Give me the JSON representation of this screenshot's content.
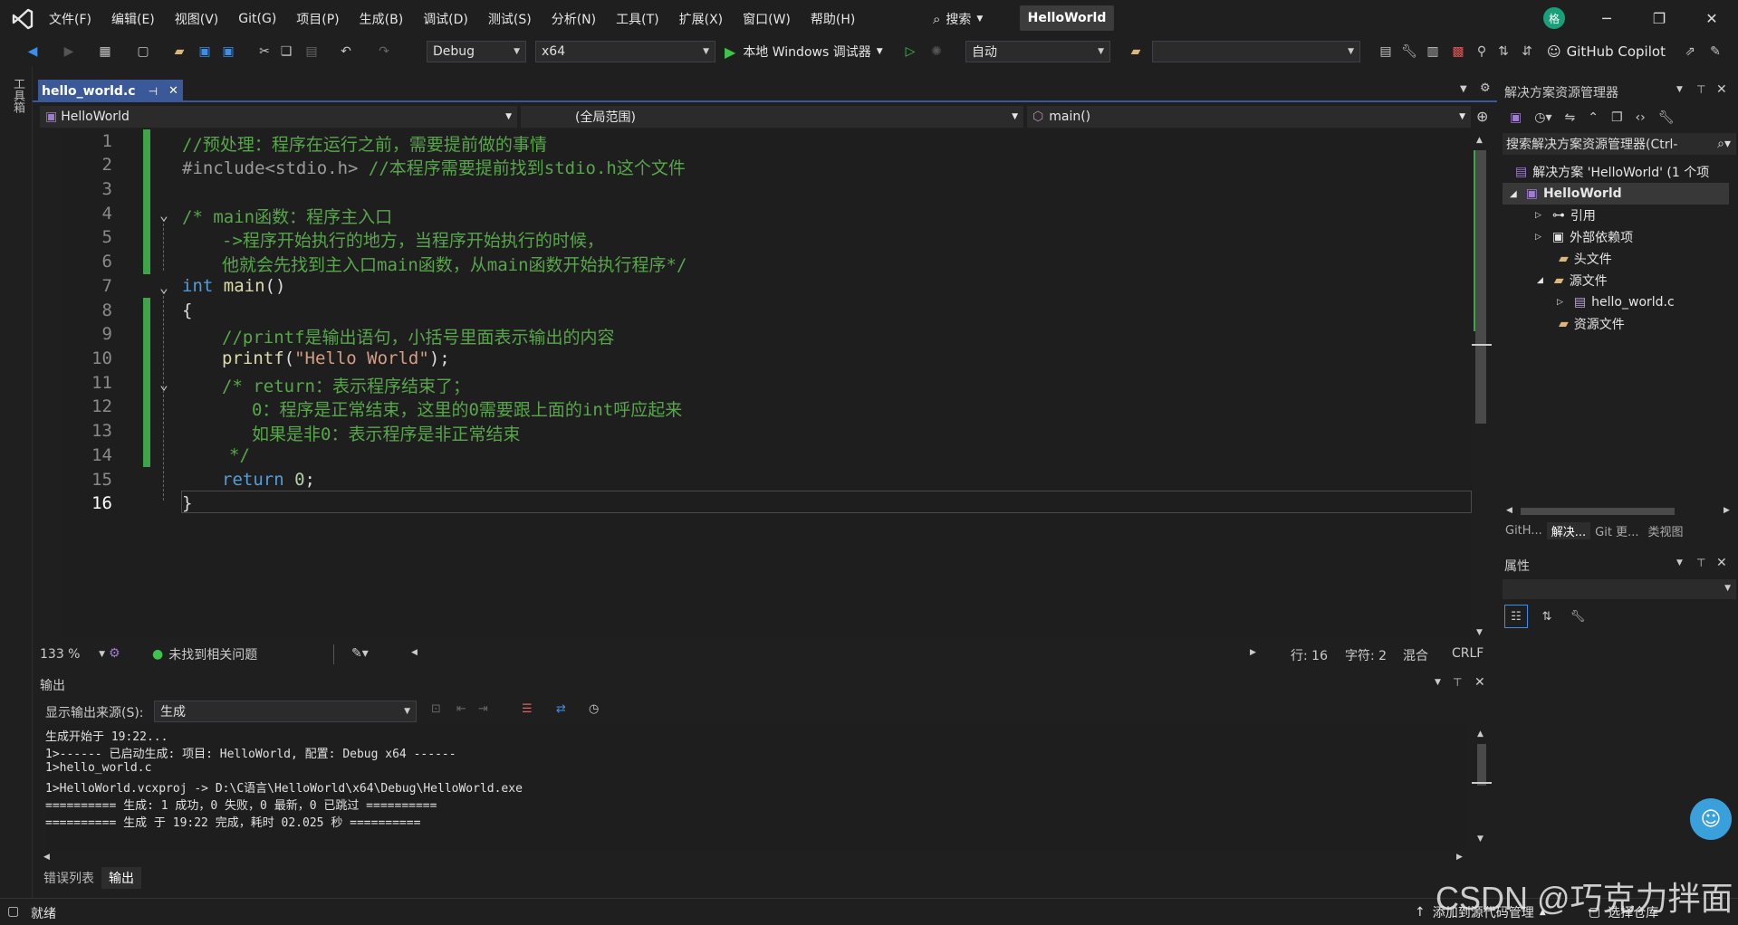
{
  "menu": {
    "items": [
      "文件(F)",
      "编辑(E)",
      "视图(V)",
      "Git(G)",
      "项目(P)",
      "生成(B)",
      "调试(D)",
      "测试(S)",
      "分析(N)",
      "工具(T)",
      "扩展(X)",
      "窗口(W)",
      "帮助(H)"
    ],
    "search": "搜索",
    "project_title": "HelloWorld",
    "avatar_initial": "格"
  },
  "toolbar": {
    "config": "Debug",
    "platform": "x64",
    "debugger_label": "本地 Windows 调试器",
    "auto_label": "自动",
    "copilot_label": "GitHub Copilot"
  },
  "leftrail": {
    "toolbox_label": "工具箱"
  },
  "editor": {
    "tab_label": "hello_world.c",
    "nav_project": "HelloWorld",
    "nav_scope": "(全局范围)",
    "nav_function": "main()",
    "line_numbers": [
      "1",
      "2",
      "3",
      "4",
      "5",
      "6",
      "7",
      "8",
      "9",
      "10",
      "11",
      "12",
      "13",
      "14",
      "15",
      "16"
    ],
    "lines": {
      "l1": "//预处理：程序在运行之前，需要提前做的事情",
      "l2a": "#include<stdio.h>",
      "l2b": " //本程序需要提前找到stdio.h这个文件",
      "l4": "/* main函数：程序主入口",
      "l5": "->程序开始执行的地方，当程序开始执行的时候，",
      "l6": "他就会先找到主入口main函数，从main函数开始执行程序*/",
      "l7kw": "int",
      "l7fn": "main",
      "l7p": "()",
      "l8": "{",
      "l9": "//printf是输出语句，小括号里面表示输出的内容",
      "l10fn": "printf",
      "l10a": "(",
      "l10s": "\"Hello World\"",
      "l10b": ");",
      "l11": "/* return：表示程序结束了；",
      "l12": "0：程序是正常结束，这里的0需要跟上面的int呼应起来",
      "l13": "如果是非0：表示程序是非正常结束",
      "l14": "*/",
      "l15kw": "return",
      "l15n": "0",
      "l15e": ";",
      "l16": "}"
    },
    "status": {
      "zoom": "133 %",
      "issues": "未找到相关问题",
      "line": "行: 16",
      "char": "字符: 2",
      "mode": "混合",
      "eol": "CRLF"
    }
  },
  "output": {
    "title": "输出",
    "source_label": "显示输出来源(S):",
    "source_value": "生成",
    "lines": [
      "生成开始于 19:22...",
      "1>------ 已启动生成: 项目: HelloWorld, 配置: Debug x64 ------",
      "1>hello_world.c",
      "1>HelloWorld.vcxproj -> D:\\C语言\\HelloWorld\\x64\\Debug\\HelloWorld.exe",
      "========== 生成: 1 成功，0 失败，0 最新，0 已跳过 ==========",
      "========== 生成 于 19:22 完成，耗时 02.025 秒 =========="
    ],
    "tabs": [
      "错误列表",
      "输出"
    ]
  },
  "solution": {
    "title": "解决方案资源管理器",
    "search_placeholder": "搜索解决方案资源管理器(Ctrl-",
    "root": "解决方案 'HelloWorld' (1 个项",
    "project": "HelloWorld",
    "items": [
      "引用",
      "外部依赖项",
      "头文件",
      "源文件",
      "hello_world.c",
      "资源文件"
    ],
    "tabs": [
      "GitH...",
      "解决...",
      "Git 更...",
      "类视图"
    ]
  },
  "properties": {
    "title": "属性"
  },
  "statusbar": {
    "ready": "就绪",
    "add_source": "添加到源代码管理",
    "select_repo": "选择仓库",
    "watermark": "CSDN @巧克力拌面"
  }
}
